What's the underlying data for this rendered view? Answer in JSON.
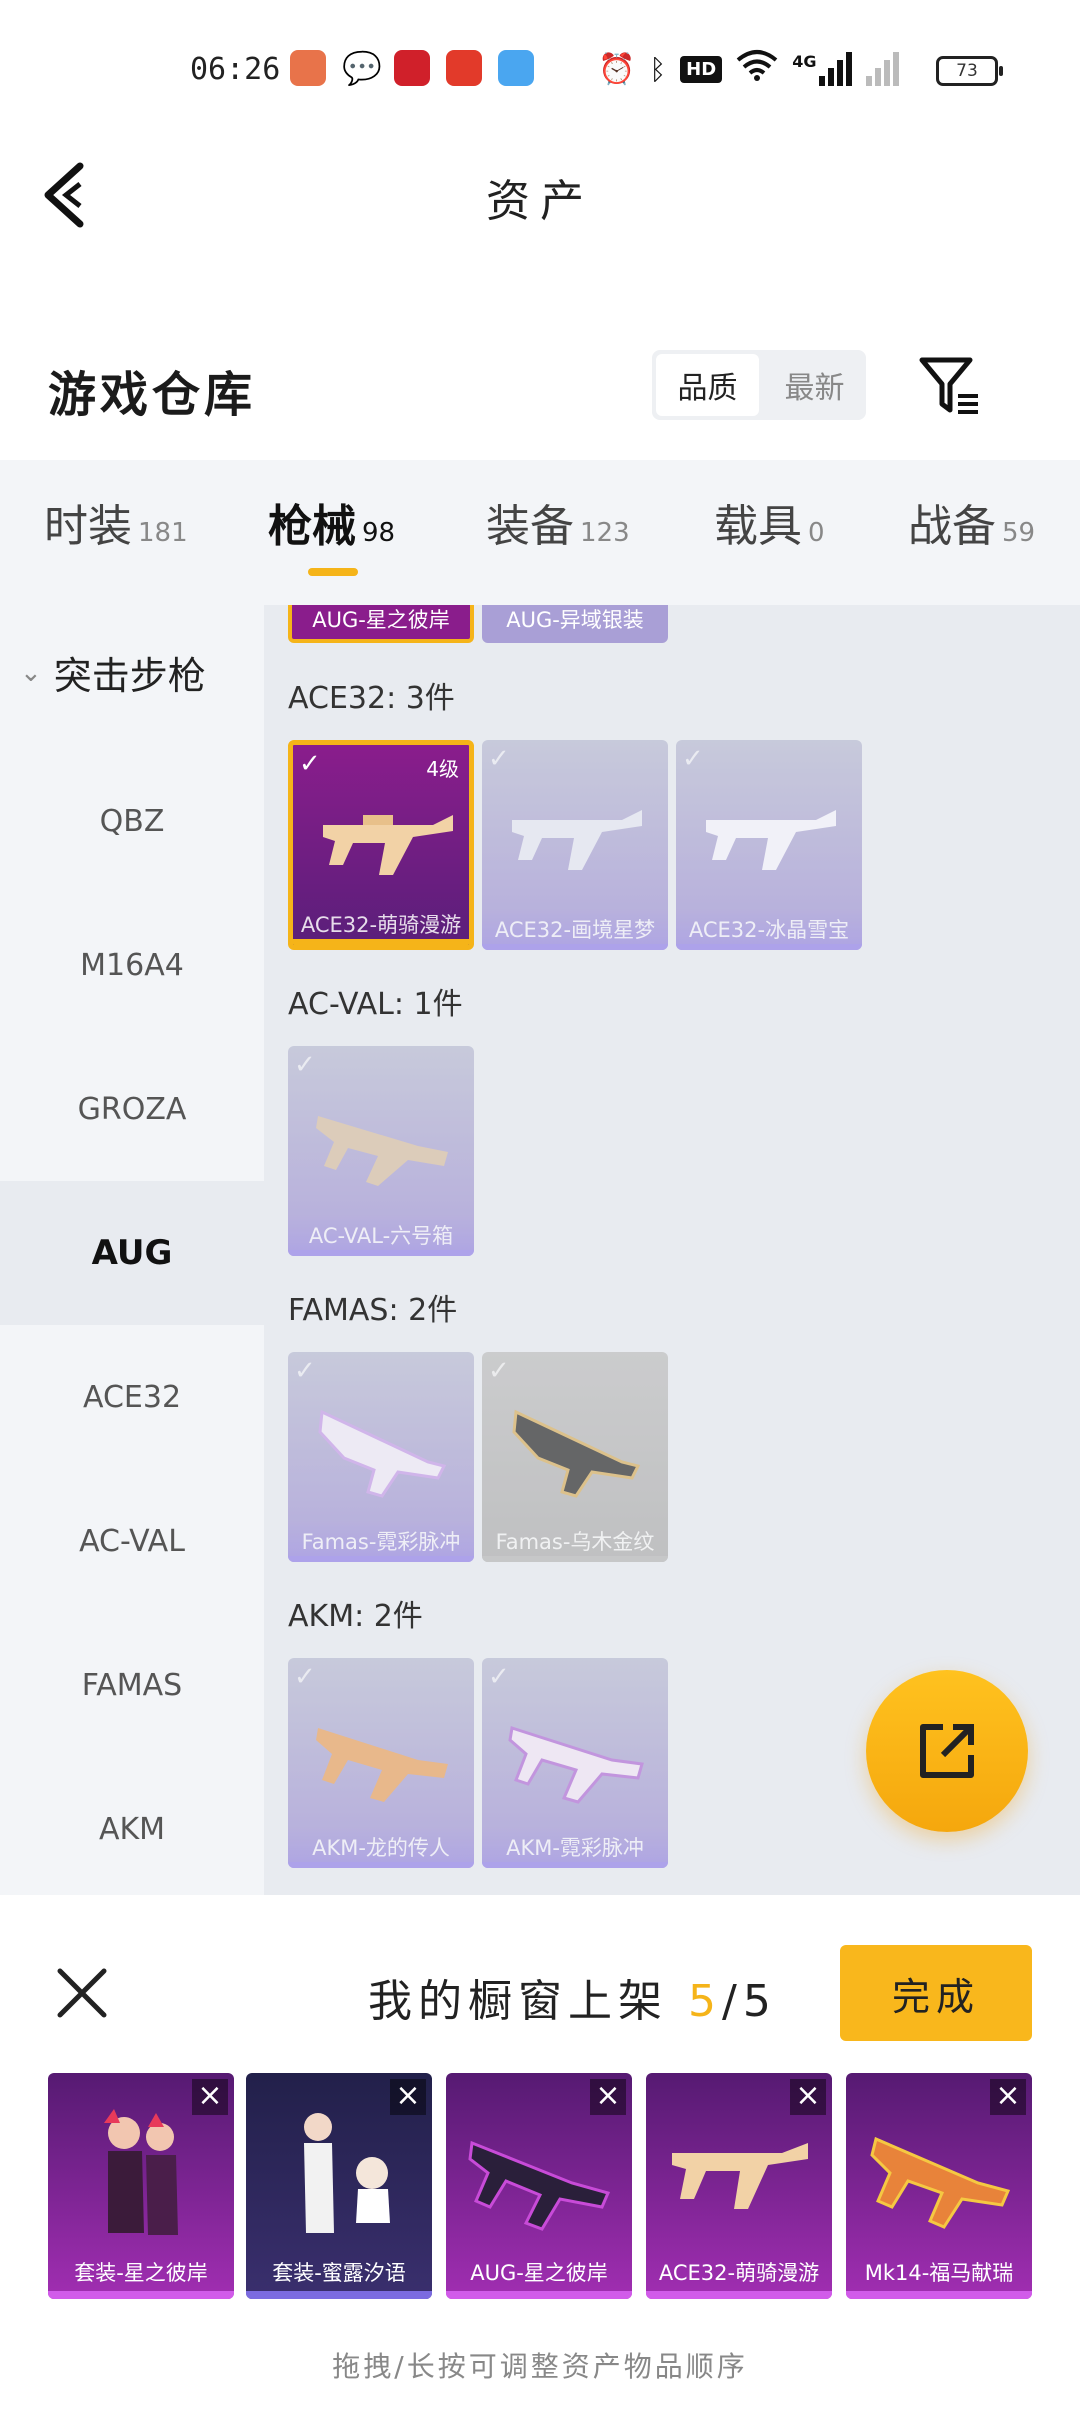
{
  "status_bar": {
    "time": "06:26",
    "network": "4G",
    "hd_badge": "HD",
    "battery": "73"
  },
  "header": {
    "title": "资产",
    "back_icon": "back-arrow-icon"
  },
  "section": {
    "title": "游戏仓库",
    "sort_options": [
      "品质",
      "最新"
    ],
    "filter_icon": "filter-icon"
  },
  "tabs": [
    {
      "label": "时装",
      "count": "181"
    },
    {
      "label": "枪械",
      "count": "98"
    },
    {
      "label": "装备",
      "count": "123"
    },
    {
      "label": "载具",
      "count": "0"
    },
    {
      "label": "战备",
      "count": "59"
    }
  ],
  "sidebar": {
    "header": "突击步枪",
    "items": [
      "QBZ",
      "M16A4",
      "GROZA",
      "AUG",
      "ACE32",
      "AC-VAL",
      "FAMAS",
      "AKM"
    ]
  },
  "main": {
    "partial_top": [
      "AUG-星之彼岸",
      "AUG-异域银装"
    ],
    "groups": [
      {
        "label": "ACE32: 3件",
        "items": [
          {
            "name": "ACE32-萌骑漫游",
            "level": "4级"
          },
          {
            "name": "ACE32-画境星梦"
          },
          {
            "name": "ACE32-冰晶雪宝"
          }
        ]
      },
      {
        "label": "AC-VAL: 1件",
        "items": [
          {
            "name": "AC-VAL-六号箱"
          }
        ]
      },
      {
        "label": "FAMAS: 2件",
        "items": [
          {
            "name": "Famas-霓彩脉冲"
          },
          {
            "name": "Famas-乌木金纹"
          }
        ]
      },
      {
        "label": "AKM: 2件",
        "items": [
          {
            "name": "AKM-龙的传人"
          },
          {
            "name": "AKM-霓彩脉冲"
          }
        ]
      }
    ],
    "share_icon": "share-icon"
  },
  "sheet": {
    "title": "我的橱窗上架",
    "count_current": "5",
    "count_total": "/5",
    "done_label": "完成",
    "items": [
      "套装-星之彼岸",
      "套装-蜜露汐语",
      "AUG-星之彼岸",
      "ACE32-萌骑漫游",
      "Mk14-福马献瑞"
    ],
    "hint": "拖拽/长按可调整资产物品顺序"
  },
  "colors": {
    "accent": "#f5b419",
    "card_purple": "#8a1d8c",
    "page_bg": "#e8ebf0"
  }
}
